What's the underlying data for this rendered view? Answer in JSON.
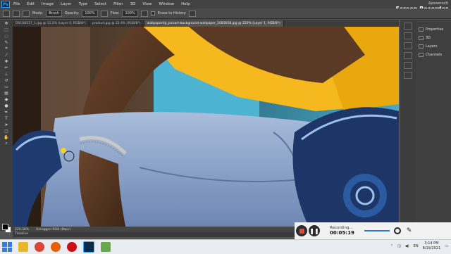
{
  "app": {
    "logo": "Ps"
  },
  "menu": [
    "File",
    "Edit",
    "Image",
    "Layer",
    "Type",
    "Select",
    "Filter",
    "3D",
    "View",
    "Window",
    "Help"
  ],
  "options": {
    "mode_label": "Mode:",
    "mode_value": "Brush",
    "opacity_label": "Opacity:",
    "opacity_value": "100%",
    "flow_label": "Flow:",
    "flow_value": "100%",
    "erase_history": "Erase to History"
  },
  "recorder_brand": {
    "small": "Apowersoft",
    "big": "Screen Recorder"
  },
  "tabs": [
    {
      "label": "DSC06517_1.jpg @ 11.2% (Layer 0, RGB/8*)"
    },
    {
      "label": "product.jpg @ 22.4% (RGB/8*)"
    },
    {
      "label": "wallpapertip_picsart-background-wallpaper_1083658.jpg @ 220% (Layer 1, RGB/8*)"
    }
  ],
  "tools": [
    "move-tool",
    "marquee-tool",
    "lasso-tool",
    "quick-select-tool",
    "crop-tool",
    "eyedropper-tool",
    "healing-tool",
    "brush-tool",
    "stamp-tool",
    "history-brush-tool",
    "eraser-tool",
    "gradient-tool",
    "blur-tool",
    "dodge-tool",
    "pen-tool",
    "type-tool",
    "path-select-tool",
    "shape-tool",
    "hand-tool",
    "zoom-tool"
  ],
  "status": {
    "zoom": "220.38%",
    "doc_info": "Untagged RGB (8bpc)"
  },
  "timeline": {
    "label": "Timeline"
  },
  "panels": [
    {
      "label": "Properties",
      "icon": "properties-icon"
    },
    {
      "label": "3D",
      "icon": "3d-icon"
    },
    {
      "label": "Layers",
      "icon": "layers-icon"
    },
    {
      "label": "Channels",
      "icon": "channels-icon"
    }
  ],
  "recorder": {
    "state": "Recording...",
    "time": "00:05:19"
  },
  "taskbar": {
    "lang": "EN",
    "time": "3:14 PM",
    "date": "8/19/2021"
  },
  "colors": {
    "accent": "#31a8ff",
    "record": "#e84535",
    "shirt": "#f5b81f",
    "jeans": "#8ea7cf"
  }
}
